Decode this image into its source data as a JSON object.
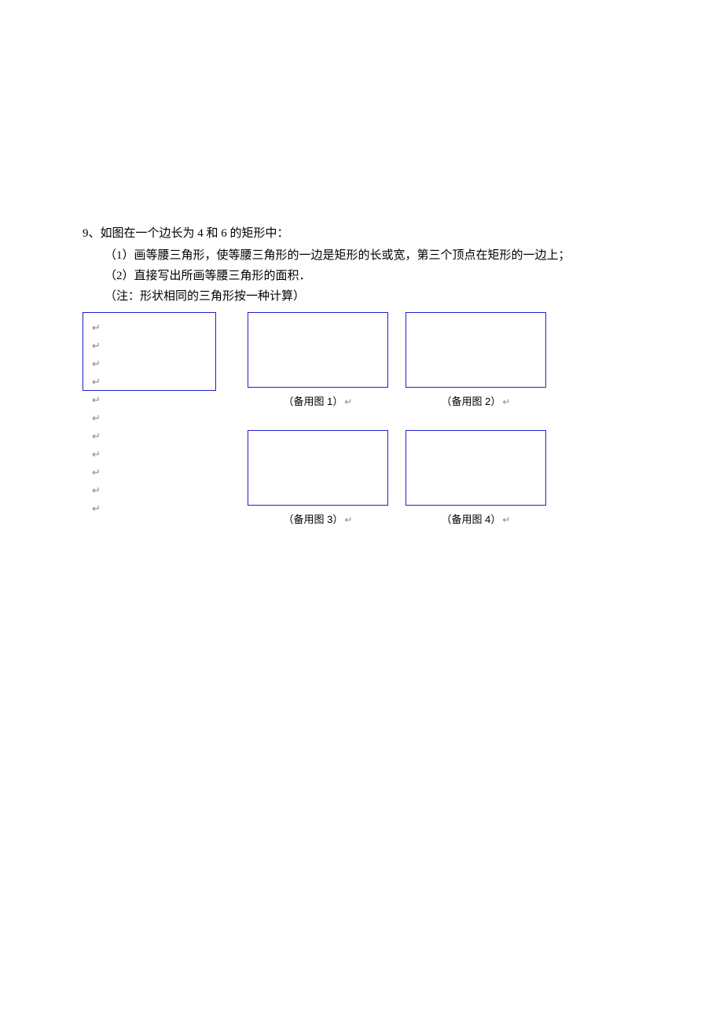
{
  "problem": {
    "number": "9、",
    "stem": "如图在一个边长为 4 和 6 的矩形中：",
    "parts": {
      "p1": "（1）画等腰三角形，使等腰三角形的一边是矩形的长或宽，第三个顶点在矩形的一边上；",
      "p2": "（2）直接写出所画等腰三角形的面积．",
      "note": "（注：形状相同的三角形按一种计算）"
    }
  },
  "figures": {
    "caption1": "（备用图 1）",
    "caption2": "（备用图 2）",
    "caption3": "（备用图 3）",
    "caption4": "（备用图 4）"
  },
  "marks": {
    "ret": "↵"
  }
}
